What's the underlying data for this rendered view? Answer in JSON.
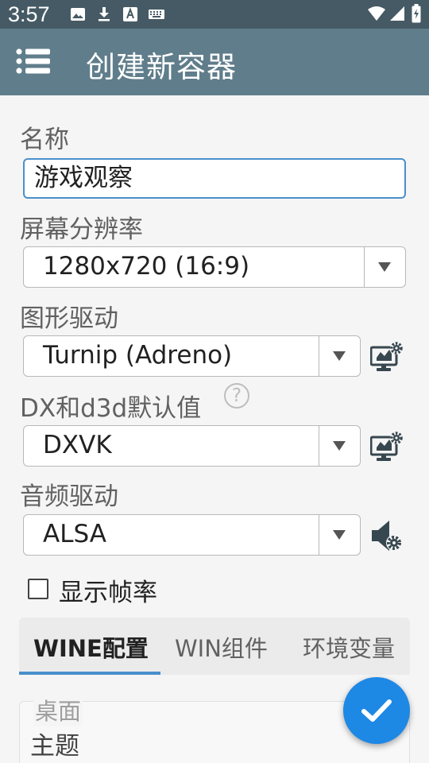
{
  "status_bar": {
    "time": "3:57",
    "icons": [
      "image-icon",
      "download-icon",
      "keyboard-a-icon",
      "keyboard-icon",
      "wifi-icon",
      "cell-signal-icon",
      "battery-icon"
    ]
  },
  "app_bar": {
    "menu_icon": "menu-icon",
    "title": "创建新容器"
  },
  "form": {
    "name": {
      "label": "名称",
      "value": "游戏观察"
    },
    "resolution": {
      "label": "屏幕分辨率",
      "value": "1280x720 (16:9)"
    },
    "graphics_driver": {
      "label": "图形驱动",
      "value": "Turnip (Adreno)",
      "config_icon": "monitor-gear-icon"
    },
    "dx_wrapper": {
      "label": "DX和d3d默认值",
      "help": "?",
      "value": "DXVK",
      "config_icon": "monitor-gear-icon"
    },
    "audio_driver": {
      "label": "音频驱动",
      "value": "ALSA",
      "config_icon": "speaker-gear-icon"
    },
    "show_fps": {
      "label": "显示帧率",
      "checked": false
    }
  },
  "tabs": [
    {
      "label": "WINE配置",
      "active": true
    },
    {
      "label": "WIN组件",
      "active": false
    },
    {
      "label": "环境变量",
      "active": false
    }
  ],
  "wine_config": {
    "section_label": "桌面",
    "item_label": "主题"
  },
  "fab": {
    "icon": "check-icon"
  },
  "colors": {
    "status_bar": "#455a64",
    "app_bar": "#607d8b",
    "accent": "#4a8fcb",
    "fab": "#1e88e5"
  }
}
